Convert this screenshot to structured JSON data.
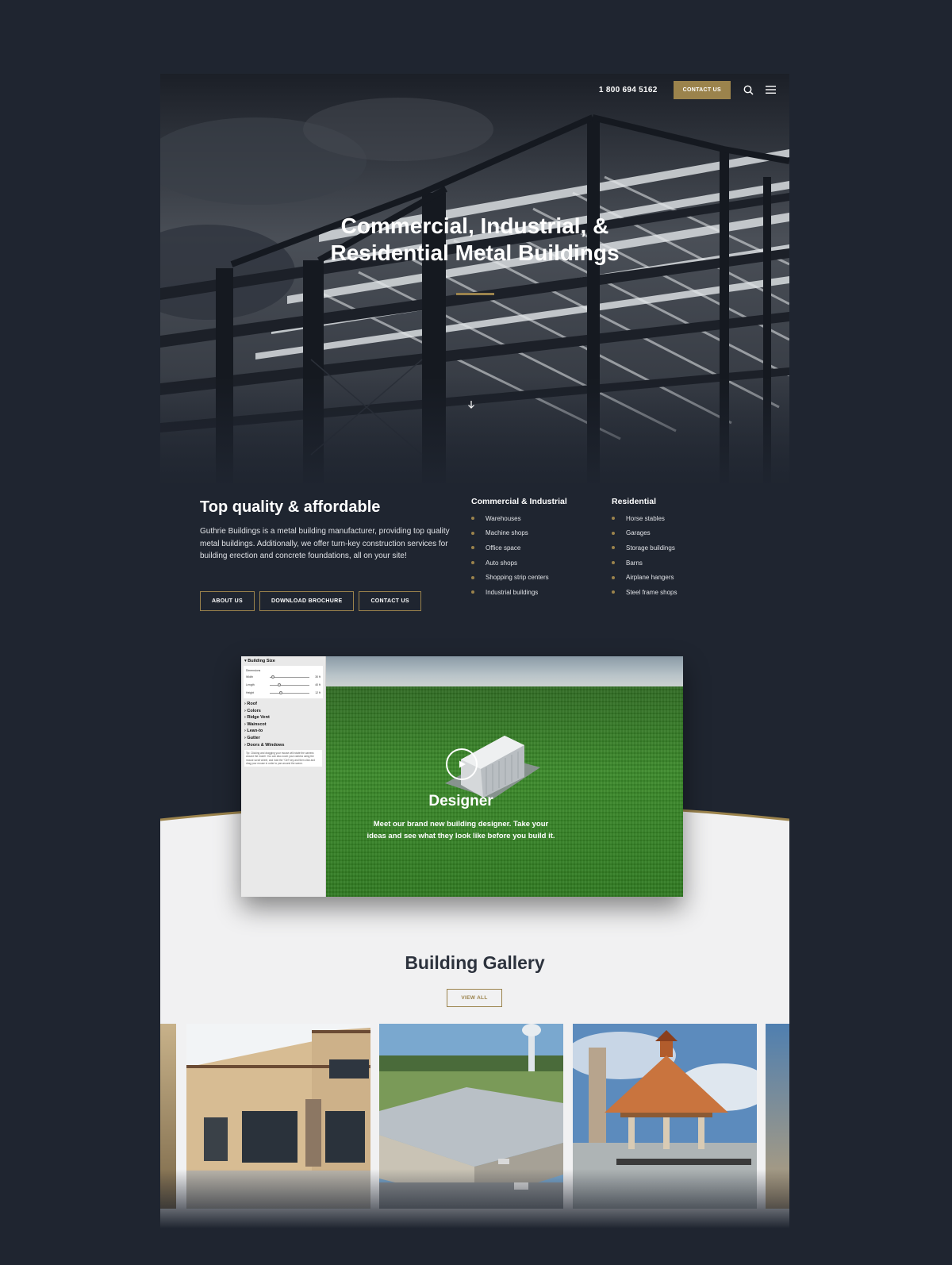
{
  "header": {
    "phone": "1 800 694 5162",
    "contact_label": "CONTACT US",
    "icons": [
      "search-icon",
      "menu-icon"
    ],
    "accent_color": "#9b834c"
  },
  "hero": {
    "title_line1": "Commercial, Industrial, &",
    "title_line2": "Residential Metal Buildings",
    "scroll_icon": "arrow-down-icon"
  },
  "intro": {
    "heading": "Top quality & affordable",
    "body": "Guthrie Buildings is a metal building manufacturer, providing top quality metal buildings. Additionally, we offer turn-key construction services for building erection and concrete foundations, all on your site!",
    "buttons": [
      "ABOUT US",
      "DOWNLOAD BROCHURE",
      "CONTACT US"
    ]
  },
  "commercial": {
    "heading": "Commercial & Industrial",
    "items": [
      "Warehouses",
      "Machine shops",
      "Office space",
      "Auto shops",
      "Shopping strip centers",
      "Industrial buildings"
    ]
  },
  "residential": {
    "heading": "Residential",
    "items": [
      "Horse stables",
      "Garages",
      "Storage buildings",
      "Barns",
      "Airplane hangers",
      "Steel frame shops"
    ]
  },
  "designer": {
    "panel": {
      "section": "Building Size",
      "sub": "Dimensions",
      "rows": [
        {
          "label": "Width",
          "value": "30 ft"
        },
        {
          "label": "Length",
          "value": "40 ft"
        },
        {
          "label": "Height",
          "value": "12 ft"
        }
      ],
      "menu": [
        "Roof",
        "Colors",
        "Ridge Vent",
        "Wainscot",
        "Lean-to",
        "Gutter",
        "Doors & Windows"
      ],
      "note": "Tip: Clicking and dragging your mouse will rotate the camera around the model. You can also zoom your camera using the mouse scroll wheel, and hold the \"Ctrl\" key and then click and drag your mouse in order to pan around the scene."
    },
    "title": "Designer",
    "text": "Meet our brand new building designer. Take your ideas and see what they look like before you build it."
  },
  "gallery": {
    "heading": "Building Gallery",
    "view_all": "VIEW ALL"
  }
}
